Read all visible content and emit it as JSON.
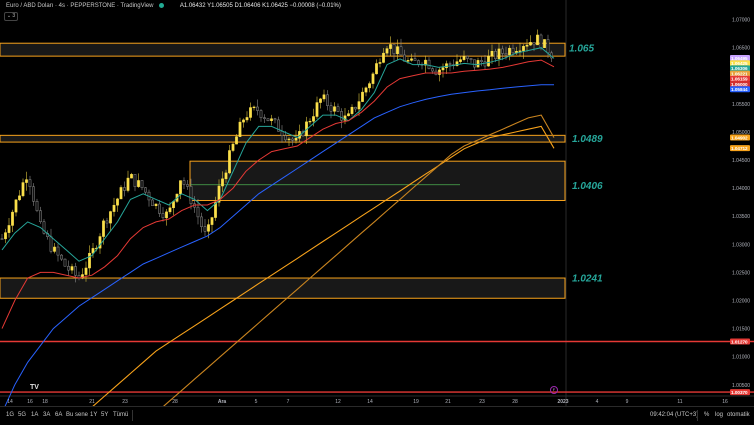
{
  "header": {
    "symbol": "Euro / ABD Doları · 4s · PEPPERSTONE · TradingView",
    "ohlc": "A1.06432 Y1.06505 D1.06406 K1.06425 −0.00008 (−0.01%)",
    "collapse_label": "⌄ 3"
  },
  "price_labels": {
    "right_axis": [
      "1.07000",
      "1.06500",
      "1.06000",
      "1.05500",
      "1.05000",
      "1.04500",
      "1.04000",
      "1.03500",
      "1.03000",
      "1.02500",
      "1.02000",
      "1.01500",
      "1.01000",
      "1.00500",
      "1.00000"
    ],
    "tags": [
      {
        "text": "1.06495",
        "color": "#c8a2ff"
      },
      {
        "text": "1.06425",
        "color": "#fbe04b"
      },
      {
        "text": "1.06306",
        "color": "#26a69a"
      },
      {
        "text": "1.06221",
        "color": "#e8a33c"
      },
      {
        "text": "1.06159",
        "color": "#e53935"
      },
      {
        "text": "1.06000",
        "color": "#d32f2f"
      },
      {
        "text": "1.05844",
        "color": "#2962ff"
      },
      {
        "text": "1.04902",
        "color": "#f7a21b"
      },
      {
        "text": "1.04712",
        "color": "#f7a21b"
      },
      {
        "text": "1.01270",
        "color": "#e53935"
      },
      {
        "text": "1.00370",
        "color": "#e53935"
      }
    ]
  },
  "levels": [
    "1.065",
    "1.0489",
    "1.0406",
    "1.0241"
  ],
  "x_axis_labels": [
    {
      "text": "14",
      "bold": false
    },
    {
      "text": "16",
      "bold": false
    },
    {
      "text": "18",
      "bold": false
    },
    {
      "text": "21",
      "bold": false
    },
    {
      "text": "23",
      "bold": false
    },
    {
      "text": "28",
      "bold": false
    },
    {
      "text": "Ara",
      "bold": true
    },
    {
      "text": "5",
      "bold": false
    },
    {
      "text": "7",
      "bold": false
    },
    {
      "text": "12",
      "bold": false
    },
    {
      "text": "14",
      "bold": false
    },
    {
      "text": "19",
      "bold": false
    },
    {
      "text": "21",
      "bold": false
    },
    {
      "text": "23",
      "bold": false
    },
    {
      "text": "28",
      "bold": false
    },
    {
      "text": "2023",
      "bold": true
    },
    {
      "text": "4",
      "bold": false
    },
    {
      "text": "9",
      "bold": false
    },
    {
      "text": "11",
      "bold": false
    },
    {
      "text": "16",
      "bold": false
    }
  ],
  "bottom_bar": {
    "timeframes": [
      "1G",
      "5G",
      "1A",
      "3A",
      "6A",
      "Bu sene",
      "1Y",
      "5Y",
      "Tümü"
    ],
    "clock": "09:42:04 (UTC+3)",
    "options": [
      "%",
      "log",
      "otomatik"
    ]
  },
  "logo_text": "TV",
  "event_marker": "F",
  "chart_data": {
    "type": "candlestick",
    "symbol": "EURUSD",
    "timeframe": "4h",
    "ylim": [
      1.003,
      1.071
    ],
    "zones": [
      {
        "low": 1.0635,
        "high": 1.0658,
        "label": "1.065"
      },
      {
        "low": 1.0482,
        "high": 1.0494,
        "label": "1.0489"
      },
      {
        "low": 1.0378,
        "high": 1.0448,
        "label": "1.0406"
      },
      {
        "low": 1.0204,
        "high": 1.024,
        "label": "1.0241"
      }
    ],
    "horizontal_lines": [
      1.0127,
      1.0037
    ],
    "close_path": [
      1.031,
      1.037,
      1.043,
      1.033,
      1.029,
      1.026,
      1.024,
      1.028,
      1.034,
      1.038,
      1.042,
      1.04,
      1.037,
      1.035,
      1.042,
      1.037,
      1.031,
      1.04,
      1.047,
      1.053,
      1.054,
      1.052,
      1.05,
      1.048,
      1.052,
      1.056,
      1.054,
      1.052,
      1.056,
      1.06,
      1.066,
      1.064,
      1.062,
      1.063,
      1.061,
      1.062,
      1.063,
      1.062,
      1.063,
      1.064,
      1.065,
      1.066,
      1.0665,
      1.064
    ],
    "moving_averages": [
      {
        "color": "#26a69a",
        "values": [
          1.029,
          1.032,
          1.034,
          1.033,
          1.031,
          1.029,
          1.027,
          1.028,
          1.031,
          1.034,
          1.038,
          1.039,
          1.038,
          1.037,
          1.039,
          1.038,
          1.036,
          1.038,
          1.043,
          1.048,
          1.051,
          1.051,
          1.05,
          1.049,
          1.051,
          1.053,
          1.053,
          1.052,
          1.054,
          1.057,
          1.062,
          1.063,
          1.062,
          1.062,
          1.0615,
          1.0618,
          1.0622,
          1.062,
          1.0624,
          1.063,
          1.064,
          1.0645,
          1.065,
          1.0631
        ]
      },
      {
        "color": "#e53935",
        "values": [
          1.015,
          1.02,
          1.024,
          1.025,
          1.025,
          1.0245,
          1.024,
          1.0245,
          1.026,
          1.028,
          1.031,
          1.033,
          1.034,
          1.0345,
          1.036,
          1.037,
          1.037,
          1.038,
          1.04,
          1.043,
          1.045,
          1.0465,
          1.047,
          1.0475,
          1.049,
          1.0505,
          1.0515,
          1.052,
          1.0535,
          1.0555,
          1.058,
          1.0595,
          1.06,
          1.0605,
          1.0605,
          1.0605,
          1.0608,
          1.061,
          1.0612,
          1.0615,
          1.062,
          1.0625,
          1.0628,
          1.0616
        ]
      },
      {
        "color": "#2962ff",
        "values": [
          1.0,
          1.005,
          1.009,
          1.012,
          1.015,
          1.017,
          1.019,
          1.0205,
          1.022,
          1.0235,
          1.025,
          1.0265,
          1.0275,
          1.0285,
          1.0295,
          1.0305,
          1.0315,
          1.033,
          1.035,
          1.037,
          1.039,
          1.0405,
          1.042,
          1.0435,
          1.045,
          1.0465,
          1.048,
          1.0495,
          1.051,
          1.0525,
          1.0535,
          1.0545,
          1.0552,
          1.0558,
          1.0563,
          1.0567,
          1.057,
          1.0573,
          1.0575,
          1.0578,
          1.058,
          1.0582,
          1.0584,
          1.0584
        ]
      },
      {
        "color": "#f7a21b",
        "values": [
          null,
          null,
          null,
          null,
          null,
          null,
          0.999,
          1.001,
          1.003,
          1.005,
          1.007,
          1.009,
          1.011,
          1.0125,
          1.014,
          1.0155,
          1.017,
          1.0185,
          1.02,
          1.0215,
          1.023,
          1.0245,
          1.026,
          1.0275,
          1.029,
          1.0305,
          1.032,
          1.0335,
          1.035,
          1.0365,
          1.038,
          1.0395,
          1.041,
          1.0425,
          1.044,
          1.0455,
          1.047,
          1.048,
          1.049,
          1.0495,
          1.05,
          1.0505,
          1.051,
          1.0471
        ]
      },
      {
        "color": "#c9841f",
        "values": [
          null,
          null,
          null,
          null,
          null,
          null,
          null,
          null,
          null,
          null,
          null,
          0.998,
          1.0,
          1.002,
          1.004,
          1.006,
          1.008,
          1.01,
          1.012,
          1.014,
          1.016,
          1.018,
          1.02,
          1.022,
          1.024,
          1.026,
          1.028,
          1.03,
          1.032,
          1.034,
          1.036,
          1.038,
          1.04,
          1.042,
          1.044,
          1.046,
          1.0475,
          1.0485,
          1.0495,
          1.0505,
          1.0515,
          1.0525,
          1.053,
          1.049
        ]
      }
    ]
  }
}
